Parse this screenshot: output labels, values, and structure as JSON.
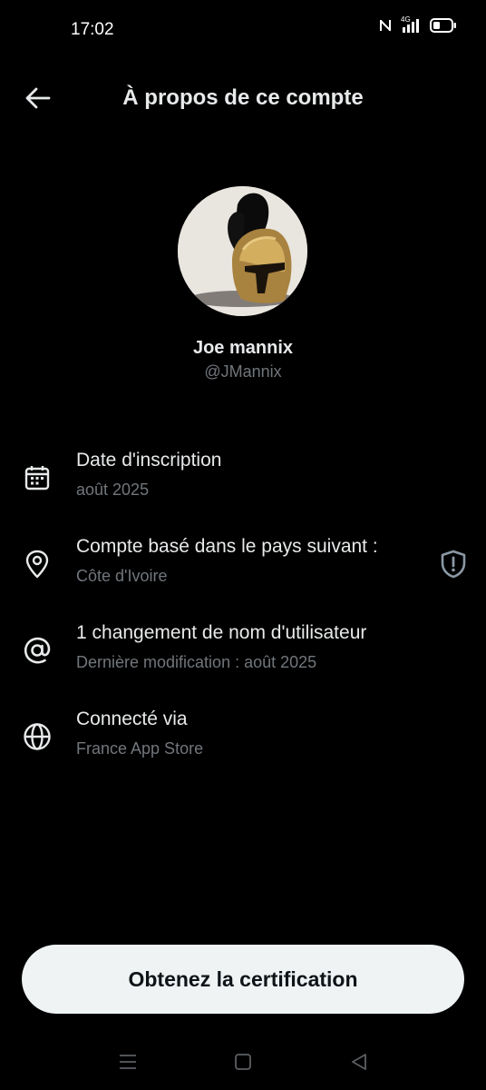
{
  "status_bar": {
    "time": "17:02",
    "network": "4G",
    "icons": [
      "nfc-icon",
      "signal-icon",
      "battery-icon"
    ]
  },
  "header": {
    "title": "À propos de ce compte",
    "back_icon": "arrow-left-icon"
  },
  "profile": {
    "name": "Joe mannix",
    "handle": "@JMannix"
  },
  "info": [
    {
      "icon": "calendar-icon",
      "title": "Date d'inscription",
      "subtitle": "août 2025"
    },
    {
      "icon": "location-pin-icon",
      "title": "Compte basé dans le pays suivant :",
      "subtitle": "Côte d'Ivoire",
      "badge_icon": "shield-icon"
    },
    {
      "icon": "at-sign-icon",
      "title": "1 changement de nom d'utilisateur",
      "subtitle": "Dernière modification : août 2025"
    },
    {
      "icon": "globe-icon",
      "title": "Connecté via",
      "subtitle": "France App Store"
    }
  ],
  "cta": {
    "label": "Obtenez la certification"
  },
  "nav_bar": {
    "icons": [
      "menu-icon",
      "home-square-icon",
      "back-triangle-icon"
    ]
  },
  "colors": {
    "background": "#000000",
    "primary_text": "#e7e9ea",
    "secondary_text": "#71767b",
    "button_bg": "#eff3f4",
    "button_text": "#0f1419"
  }
}
